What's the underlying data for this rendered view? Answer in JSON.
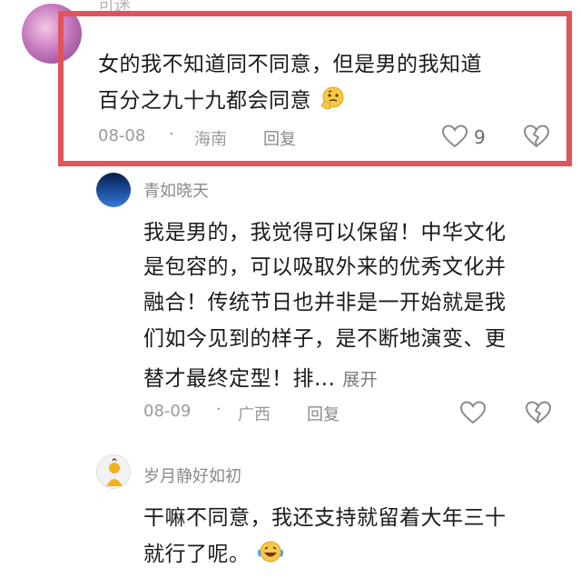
{
  "comments": [
    {
      "username": "可迷",
      "text_lines": [
        "女的我不知道同不同意，但是男的我知道",
        "百分之九十九都会同意"
      ],
      "emoji": "thinking-face-emoji",
      "date": "08-08",
      "location": "海南",
      "reply_label": "回复",
      "like_count": "9"
    },
    {
      "username": "青如晓天",
      "text_lines": [
        "我是男的，我觉得可以保留！中华文化",
        "是包容的，可以吸取外来的优秀文化并",
        "融合！传统节日也并非是一开始就是我",
        "们如今见到的样子，是不断地演变、更",
        "替才最终定型！排..."
      ],
      "expand_label": "展开",
      "date": "08-09",
      "location": "广西",
      "reply_label": "回复"
    },
    {
      "username": "岁月静好如初",
      "text_lines": [
        "干嘛不同意，我还支持就留着大年三十",
        "就行了呢。"
      ],
      "emoji": "laughing-tears-emoji"
    }
  ],
  "colors": {
    "highlight_border": "#e0545a",
    "meta_gray": "#9a9a9a",
    "username_gray": "#8a8a8a"
  }
}
